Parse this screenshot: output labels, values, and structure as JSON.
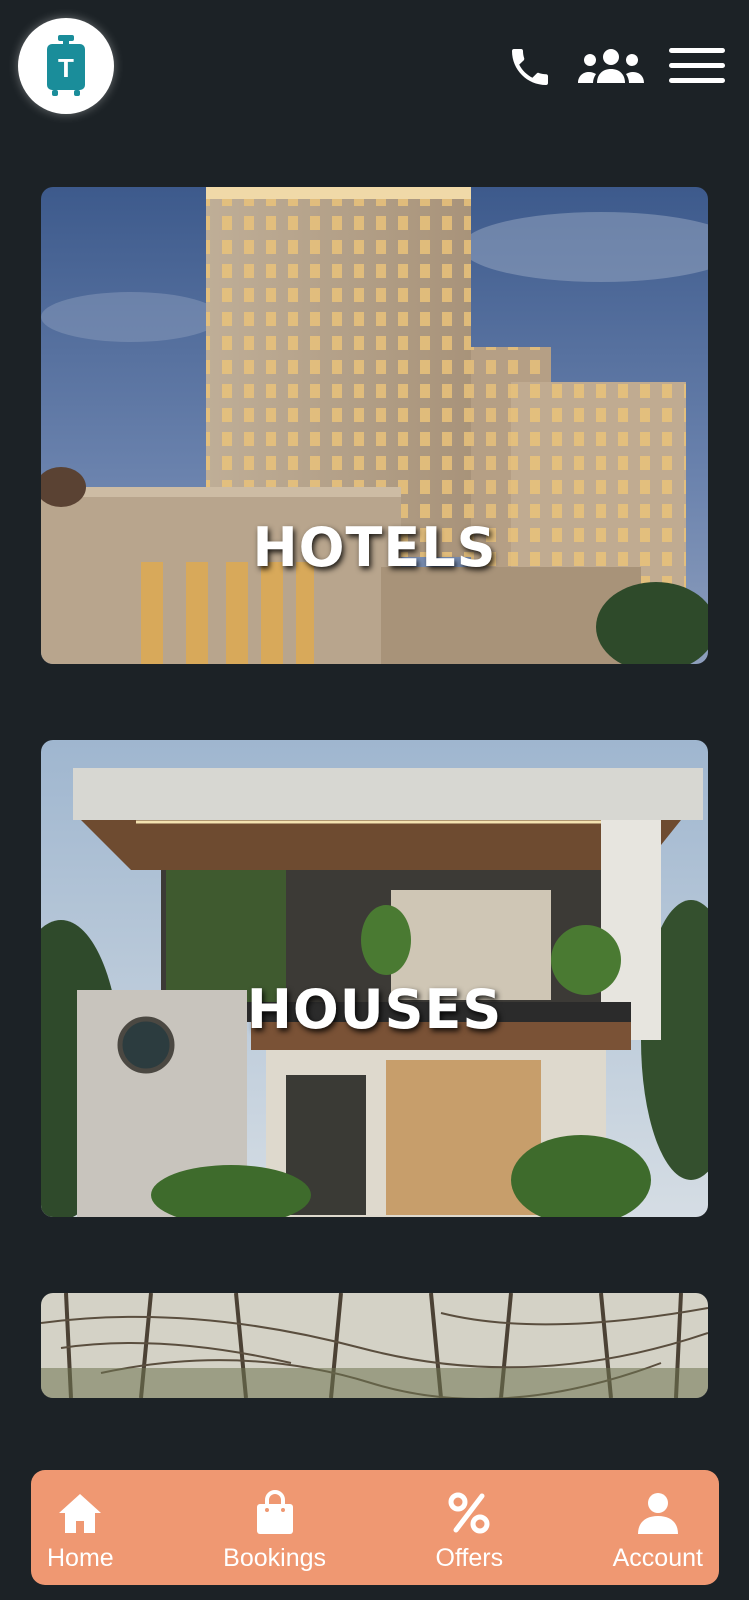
{
  "app": {
    "logo_letter": "T",
    "logo_icon": "suitcase-icon"
  },
  "header": {
    "icons": [
      "phone-icon",
      "group-icon",
      "hamburger-menu-icon"
    ]
  },
  "cards": [
    {
      "label": "HOTELS"
    },
    {
      "label": "HOUSES"
    },
    {
      "label": ""
    }
  ],
  "bottom_nav": {
    "items": [
      {
        "label": "Home",
        "icon": "home-icon"
      },
      {
        "label": "Bookings",
        "icon": "shopping-bag-icon"
      },
      {
        "label": "Offers",
        "icon": "percent-icon"
      },
      {
        "label": "Account",
        "icon": "user-icon"
      }
    ]
  },
  "colors": {
    "background": "#1c2226",
    "accent": "#ef9872",
    "logo_teal": "#1a8d9a"
  }
}
